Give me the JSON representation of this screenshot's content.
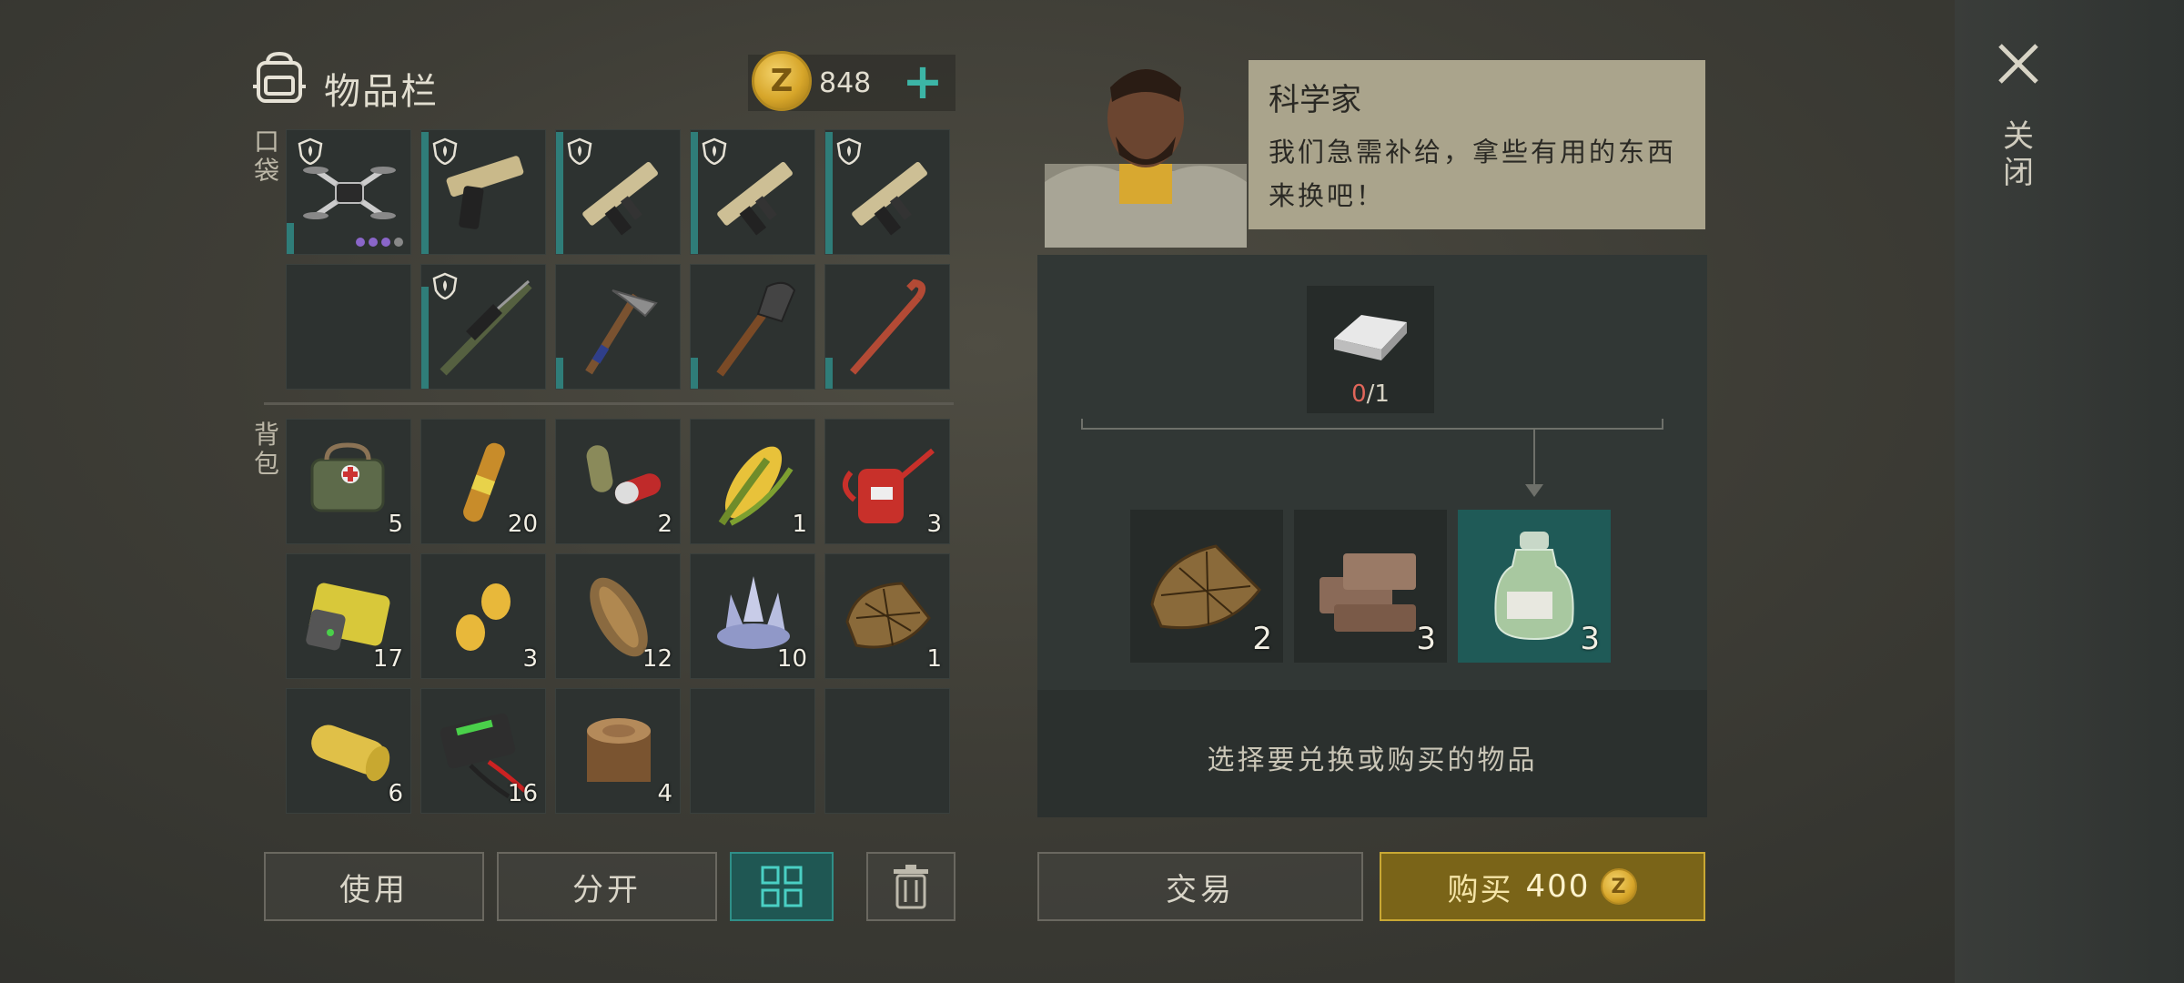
{
  "header": {
    "title": "物品栏",
    "coins": "848",
    "add_icon": "plus-icon",
    "bag_icon": "backpack-icon"
  },
  "sections": {
    "pockets": "口袋",
    "backpack": "背包"
  },
  "pockets": [
    {
      "name": "drone",
      "qty": "",
      "locked": true
    },
    {
      "name": "pistol",
      "qty": "",
      "locked": true
    },
    {
      "name": "rifle",
      "qty": "",
      "locked": true
    },
    {
      "name": "rifle",
      "qty": "",
      "locked": true
    },
    {
      "name": "rifle",
      "qty": "",
      "locked": true
    },
    {
      "name": "empty",
      "qty": "",
      "locked": false
    },
    {
      "name": "sniper-rifle",
      "qty": "",
      "locked": true
    },
    {
      "name": "pickaxe",
      "qty": "",
      "locked": false
    },
    {
      "name": "shovel",
      "qty": "",
      "locked": false
    },
    {
      "name": "crowbar",
      "qty": "",
      "locked": false
    }
  ],
  "backpack": [
    {
      "name": "medkit-bag",
      "qty": "5"
    },
    {
      "name": "ampoule",
      "qty": "20"
    },
    {
      "name": "pills",
      "qty": "2"
    },
    {
      "name": "corn",
      "qty": "1"
    },
    {
      "name": "oil-can",
      "qty": "3"
    },
    {
      "name": "battery",
      "qty": "17"
    },
    {
      "name": "seeds",
      "qty": "3"
    },
    {
      "name": "shell-creature",
      "qty": "12"
    },
    {
      "name": "crystal",
      "qty": "10"
    },
    {
      "name": "leather-scrap",
      "qty": "1"
    },
    {
      "name": "fabric-roll",
      "qty": "6"
    },
    {
      "name": "car-battery",
      "qty": "16"
    },
    {
      "name": "log",
      "qty": "4"
    },
    {
      "name": "empty",
      "qty": ""
    },
    {
      "name": "empty",
      "qty": ""
    }
  ],
  "buttons": {
    "use": "使用",
    "split": "分开",
    "trade": "交易",
    "buy": "购买",
    "buy_price": "400"
  },
  "trader": {
    "name": "科学家",
    "message": "我们急需补给，拿些有用的东西来换吧！"
  },
  "trade": {
    "need_item": "silver-ingot",
    "need_have": "0",
    "need_total": "/1",
    "offers": [
      {
        "name": "leather",
        "qty": "2",
        "selected": false
      },
      {
        "name": "bricks",
        "qty": "3",
        "selected": false
      },
      {
        "name": "acid-bottle",
        "qty": "3",
        "selected": true
      }
    ],
    "hint": "选择要兑换或购买的物品"
  },
  "close": {
    "label": "关闭"
  },
  "colors": {
    "accent": "#2f8f88",
    "gold": "#c9a834",
    "warning": "#e0665a"
  }
}
